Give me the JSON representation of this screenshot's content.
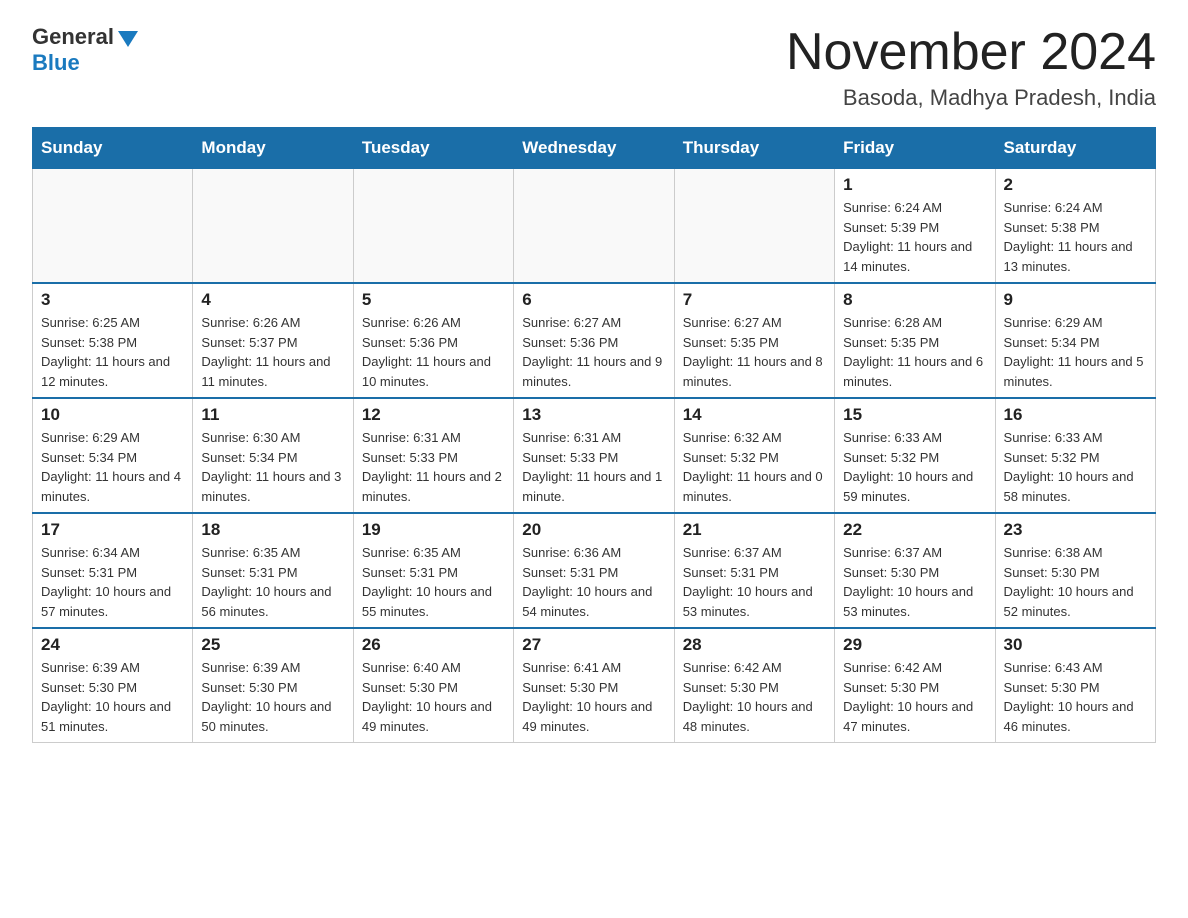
{
  "header": {
    "logo_general": "General",
    "logo_blue": "Blue",
    "month_title": "November 2024",
    "location": "Basoda, Madhya Pradesh, India"
  },
  "weekdays": [
    "Sunday",
    "Monday",
    "Tuesday",
    "Wednesday",
    "Thursday",
    "Friday",
    "Saturday"
  ],
  "weeks": [
    [
      {
        "day": "",
        "sunrise": "",
        "sunset": "",
        "daylight": ""
      },
      {
        "day": "",
        "sunrise": "",
        "sunset": "",
        "daylight": ""
      },
      {
        "day": "",
        "sunrise": "",
        "sunset": "",
        "daylight": ""
      },
      {
        "day": "",
        "sunrise": "",
        "sunset": "",
        "daylight": ""
      },
      {
        "day": "",
        "sunrise": "",
        "sunset": "",
        "daylight": ""
      },
      {
        "day": "1",
        "sunrise": "Sunrise: 6:24 AM",
        "sunset": "Sunset: 5:39 PM",
        "daylight": "Daylight: 11 hours and 14 minutes."
      },
      {
        "day": "2",
        "sunrise": "Sunrise: 6:24 AM",
        "sunset": "Sunset: 5:38 PM",
        "daylight": "Daylight: 11 hours and 13 minutes."
      }
    ],
    [
      {
        "day": "3",
        "sunrise": "Sunrise: 6:25 AM",
        "sunset": "Sunset: 5:38 PM",
        "daylight": "Daylight: 11 hours and 12 minutes."
      },
      {
        "day": "4",
        "sunrise": "Sunrise: 6:26 AM",
        "sunset": "Sunset: 5:37 PM",
        "daylight": "Daylight: 11 hours and 11 minutes."
      },
      {
        "day": "5",
        "sunrise": "Sunrise: 6:26 AM",
        "sunset": "Sunset: 5:36 PM",
        "daylight": "Daylight: 11 hours and 10 minutes."
      },
      {
        "day": "6",
        "sunrise": "Sunrise: 6:27 AM",
        "sunset": "Sunset: 5:36 PM",
        "daylight": "Daylight: 11 hours and 9 minutes."
      },
      {
        "day": "7",
        "sunrise": "Sunrise: 6:27 AM",
        "sunset": "Sunset: 5:35 PM",
        "daylight": "Daylight: 11 hours and 8 minutes."
      },
      {
        "day": "8",
        "sunrise": "Sunrise: 6:28 AM",
        "sunset": "Sunset: 5:35 PM",
        "daylight": "Daylight: 11 hours and 6 minutes."
      },
      {
        "day": "9",
        "sunrise": "Sunrise: 6:29 AM",
        "sunset": "Sunset: 5:34 PM",
        "daylight": "Daylight: 11 hours and 5 minutes."
      }
    ],
    [
      {
        "day": "10",
        "sunrise": "Sunrise: 6:29 AM",
        "sunset": "Sunset: 5:34 PM",
        "daylight": "Daylight: 11 hours and 4 minutes."
      },
      {
        "day": "11",
        "sunrise": "Sunrise: 6:30 AM",
        "sunset": "Sunset: 5:34 PM",
        "daylight": "Daylight: 11 hours and 3 minutes."
      },
      {
        "day": "12",
        "sunrise": "Sunrise: 6:31 AM",
        "sunset": "Sunset: 5:33 PM",
        "daylight": "Daylight: 11 hours and 2 minutes."
      },
      {
        "day": "13",
        "sunrise": "Sunrise: 6:31 AM",
        "sunset": "Sunset: 5:33 PM",
        "daylight": "Daylight: 11 hours and 1 minute."
      },
      {
        "day": "14",
        "sunrise": "Sunrise: 6:32 AM",
        "sunset": "Sunset: 5:32 PM",
        "daylight": "Daylight: 11 hours and 0 minutes."
      },
      {
        "day": "15",
        "sunrise": "Sunrise: 6:33 AM",
        "sunset": "Sunset: 5:32 PM",
        "daylight": "Daylight: 10 hours and 59 minutes."
      },
      {
        "day": "16",
        "sunrise": "Sunrise: 6:33 AM",
        "sunset": "Sunset: 5:32 PM",
        "daylight": "Daylight: 10 hours and 58 minutes."
      }
    ],
    [
      {
        "day": "17",
        "sunrise": "Sunrise: 6:34 AM",
        "sunset": "Sunset: 5:31 PM",
        "daylight": "Daylight: 10 hours and 57 minutes."
      },
      {
        "day": "18",
        "sunrise": "Sunrise: 6:35 AM",
        "sunset": "Sunset: 5:31 PM",
        "daylight": "Daylight: 10 hours and 56 minutes."
      },
      {
        "day": "19",
        "sunrise": "Sunrise: 6:35 AM",
        "sunset": "Sunset: 5:31 PM",
        "daylight": "Daylight: 10 hours and 55 minutes."
      },
      {
        "day": "20",
        "sunrise": "Sunrise: 6:36 AM",
        "sunset": "Sunset: 5:31 PM",
        "daylight": "Daylight: 10 hours and 54 minutes."
      },
      {
        "day": "21",
        "sunrise": "Sunrise: 6:37 AM",
        "sunset": "Sunset: 5:31 PM",
        "daylight": "Daylight: 10 hours and 53 minutes."
      },
      {
        "day": "22",
        "sunrise": "Sunrise: 6:37 AM",
        "sunset": "Sunset: 5:30 PM",
        "daylight": "Daylight: 10 hours and 53 minutes."
      },
      {
        "day": "23",
        "sunrise": "Sunrise: 6:38 AM",
        "sunset": "Sunset: 5:30 PM",
        "daylight": "Daylight: 10 hours and 52 minutes."
      }
    ],
    [
      {
        "day": "24",
        "sunrise": "Sunrise: 6:39 AM",
        "sunset": "Sunset: 5:30 PM",
        "daylight": "Daylight: 10 hours and 51 minutes."
      },
      {
        "day": "25",
        "sunrise": "Sunrise: 6:39 AM",
        "sunset": "Sunset: 5:30 PM",
        "daylight": "Daylight: 10 hours and 50 minutes."
      },
      {
        "day": "26",
        "sunrise": "Sunrise: 6:40 AM",
        "sunset": "Sunset: 5:30 PM",
        "daylight": "Daylight: 10 hours and 49 minutes."
      },
      {
        "day": "27",
        "sunrise": "Sunrise: 6:41 AM",
        "sunset": "Sunset: 5:30 PM",
        "daylight": "Daylight: 10 hours and 49 minutes."
      },
      {
        "day": "28",
        "sunrise": "Sunrise: 6:42 AM",
        "sunset": "Sunset: 5:30 PM",
        "daylight": "Daylight: 10 hours and 48 minutes."
      },
      {
        "day": "29",
        "sunrise": "Sunrise: 6:42 AM",
        "sunset": "Sunset: 5:30 PM",
        "daylight": "Daylight: 10 hours and 47 minutes."
      },
      {
        "day": "30",
        "sunrise": "Sunrise: 6:43 AM",
        "sunset": "Sunset: 5:30 PM",
        "daylight": "Daylight: 10 hours and 46 minutes."
      }
    ]
  ]
}
